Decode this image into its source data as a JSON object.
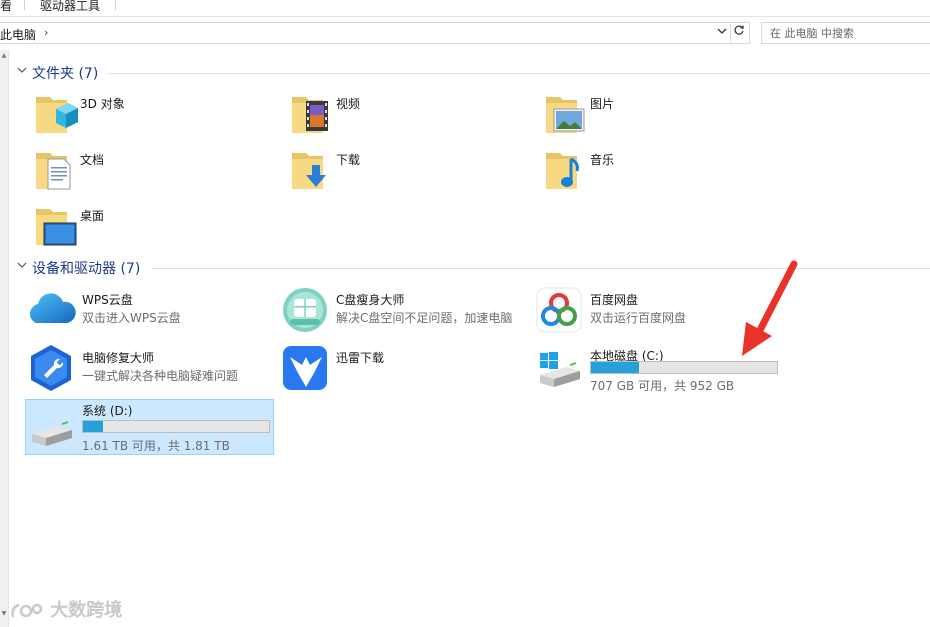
{
  "ribbon": {
    "tabs": [
      "看",
      "驱动器工具"
    ]
  },
  "address": {
    "path": [
      "此电脑"
    ],
    "separator": "›"
  },
  "search": {
    "placeholder": "在 此电脑 中搜索"
  },
  "groups": [
    {
      "title": "文件夹",
      "count": "(7)"
    },
    {
      "title": "设备和驱动器",
      "count": "(7)"
    }
  ],
  "folders": [
    {
      "label": "3D 对象",
      "icon": "3d-objects-folder-icon"
    },
    {
      "label": "视频",
      "icon": "videos-folder-icon"
    },
    {
      "label": "图片",
      "icon": "pictures-folder-icon"
    },
    {
      "label": "文档",
      "icon": "documents-folder-icon"
    },
    {
      "label": "下载",
      "icon": "downloads-folder-icon"
    },
    {
      "label": "音乐",
      "icon": "music-folder-icon"
    },
    {
      "label": "桌面",
      "icon": "desktop-folder-icon"
    }
  ],
  "devices": [
    {
      "label": "WPS云盘",
      "sub": "双击进入WPS云盘",
      "icon": "wps-cloud-icon"
    },
    {
      "label": "C盘瘦身大师",
      "sub": "解决C盘空间不足问题，加速电脑",
      "icon": "c-drive-cleaner-icon"
    },
    {
      "label": "百度网盘",
      "sub": "双击运行百度网盘",
      "icon": "baidu-netdisk-icon"
    },
    {
      "label": "电脑修复大师",
      "sub": "一键式解决各种电脑疑难问题",
      "icon": "pc-repair-icon"
    },
    {
      "label": "迅雷下载",
      "sub": "",
      "icon": "xunlei-icon"
    }
  ],
  "drives": [
    {
      "label": "本地磁盘 (C:)",
      "space": "707 GB 可用，共 952 GB",
      "used_fraction": 0.26,
      "icon": "windows-drive-icon"
    },
    {
      "label": "系统 (D:)",
      "space": "1.61 TB 可用，共 1.81 TB",
      "used_fraction": 0.11,
      "icon": "hard-drive-icon",
      "selected": true
    }
  ],
  "annotation": {
    "arrow_color": "#e8322b"
  },
  "colors": {
    "accent": "#26a0da",
    "selection": "#cce8ff",
    "group_title": "#1e3a8a"
  },
  "watermark": {
    "text": "大数跨境"
  }
}
